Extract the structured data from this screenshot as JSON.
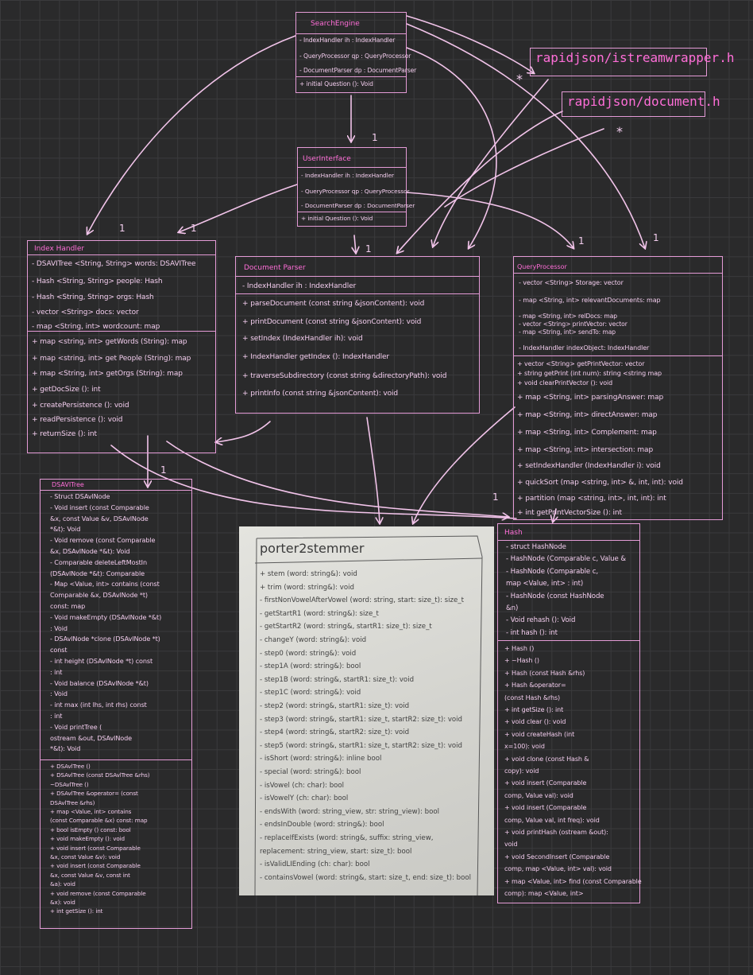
{
  "colors": {
    "background": "#2a2a2b",
    "ink": "#e49bd6",
    "title": "#ff6ed8"
  },
  "search_engine": {
    "title": "SearchEngine",
    "fields": [
      "- IndexHandler ih : IndexHandler",
      "- QueryProcessor qp : QueryProcessor",
      "- DocumentParser dp : DocumentParser"
    ],
    "methods": [
      "+ initial Question (): Void"
    ]
  },
  "libs": [
    "rapidjson/istreamwrapper.h",
    "rapidjson/document.h"
  ],
  "user_interface": {
    "title": "UserInterface",
    "fields": [
      "- IndexHandler ih : IndexHandler",
      "- QueryProcessor qp : QueryProcessor",
      "- DocumentParser dp : DocumentParser"
    ],
    "methods": [
      "+ initial Question (): Void"
    ]
  },
  "index_handler": {
    "title": "Index Handler",
    "fields": [
      "- DSAVITree <String, String> words: DSAVITree",
      "- Hash <String, String> people: Hash",
      "- Hash <String, String> orgs: Hash",
      "- vector <String> docs: vector",
      "- map <String, int> wordcount: map"
    ],
    "methods": [
      "+ map <string, int> getWords (String): map",
      "+ map <string, int> get People (String): map",
      "+ map <String, int> getOrgs (String): map",
      "+ getDocSize (): int",
      "+ createPersistence (): void",
      "+ readPersistence (): void",
      "+ returnSize (): int"
    ]
  },
  "document_parser": {
    "title": "Document Parser",
    "fields": [
      "- IndexHandler ih : IndexHandler"
    ],
    "methods": [
      "+ parseDocument (const string &jsonContent): void",
      "+ printDocument (const string &jsonContent): void",
      "+ setIndex (IndexHandler ih): void",
      "+ IndexHandler getIndex (): IndexHandler",
      "+ traverseSubdirectory (const string &directoryPath): void",
      "+ printInfo (const string &jsonContent): void"
    ]
  },
  "query_processor": {
    "title": "QueryProcessor",
    "fields": [
      "- vector <String> Storage: vector",
      "- map <String, int> relevantDocuments: map",
      "- map <String, int> relDocs: map",
      "- vector <String> printVector: vector",
      "- map <String, int> sendTo: map",
      "- IndexHandler indexObject: IndexHandler"
    ],
    "methods": [
      "+ vector <String> getPrintVector: vector",
      "+ string getPrint (int num): string <string map",
      "+ void clearPrintVector (): void",
      "+ map <String, int> parsingAnswer: map",
      "+ map <String, int> directAnswer: map",
      "+ map <String, int> Complement: map",
      "+ map <String, int> intersection: map",
      "+ setIndexHandler (IndexHandler i): void",
      "+ quickSort (map <string, int> &, int, int): void",
      "+ partition (map <string, int>, int, int): int",
      "+ int getPrintVectorSize (): int"
    ]
  },
  "dsavl_tree": {
    "title": "DSAVITree",
    "fields": [
      "- Struct DSAvlNode",
      "- Void insert (const Comparable",
      "  &x, const Value &v, DSAvlNode",
      "  *&t): Void",
      "- Void remove (const Comparable",
      "  &x, DSAvlNode *&t): Void",
      "- Comparable deleteLeftMostIn",
      "  (DSAvlNode *&t): Comparable",
      "- Map <Value, int> contains (const",
      "  Comparable &x, DSAvlNode *t)",
      "  const: map",
      "- Void makeEmpty (DSAvlNode *&t)",
      "  : Void",
      "- DSAvlNode *clone (DSAvlNode *t)",
      "  const",
      "- int height (DSAvlNode *t) const",
      "  : int",
      "- Void balance (DSAvlNode *&t)",
      "  : Void",
      "- int max (int lhs, int rhs) const",
      "  : int",
      "- Void printTree (",
      "  ostream &out, DSAvlNode",
      "  *&t): Void"
    ],
    "methods": [
      "+ DSAvlTree ()",
      "+ DSAvlTree (const DSAvlTree &rhs)",
      "  ~DSAvlTree ()",
      "+ DSAvlTree &operator= (const",
      "  DSAvlTree &rhs)",
      "+ map <Value, int> contains",
      "  (const Comparable &x) const: map",
      "+ bool isEmpty () const: bool",
      "+ void makeEmpty (): void",
      "+ void insert (const Comparable",
      "  &x, const Value &v): void",
      "+ void insert (const Comparable",
      "  &x, const Value &v, const int",
      "  &a): void",
      "+ void remove (const Comparable",
      "  &x): void",
      "+ int getSize (): int"
    ]
  },
  "porter": {
    "title": "porter2stemmer",
    "methods": [
      "+ stem (word: string&): void",
      "+ trim (word: string&): void",
      "- firstNonVowelAfterVowel (word: string, start: size_t): size_t",
      "- getStartR1 (word: string&): size_t",
      "- getStartR2 (word: string&, startR1: size_t): size_t",
      "- changeY (word: string&): void",
      "- step0 (word: string&): void",
      "- step1A (word: string&): bool",
      "- step1B (word: string&, startR1: size_t): void",
      "- step1C (word: string&): void",
      "- step2 (word: string&, startR1: size_t): void",
      "- step3 (word: string&, startR1: size_t, startR2: size_t): void",
      "- step4 (word: string&, startR2: size_t): void",
      "- step5 (word: string&, startR1: size_t, startR2: size_t): void",
      "- isShort (word: string&): inline bool",
      "- special (word: string&): bool",
      "- isVowel (ch: char): bool",
      "- isVowelY (ch: char): bool",
      "- endsWith (word: string_view, str: string_view): bool",
      "- endsInDouble (word: string&): bool",
      "- replaceIfExists (word: string&, suffix: string_view,",
      "    replacement: string_view, start: size_t): bool",
      "- isValidLIEnding (ch: char): bool",
      "- containsVowel (word: string&, start: size_t, end: size_t): bool"
    ]
  },
  "hash": {
    "title": "Hash",
    "fields": [
      "- struct HashNode",
      "- HashNode (Comparable c, Value &",
      "- HashNode (Comparable c,",
      "  map <Value, int> : int)",
      "- HashNode (const HashNode",
      "  &n)",
      "- Void rehash (): Void",
      "- int hash (): int"
    ],
    "methods": [
      "+ Hash ()",
      "+ ~Hash ()",
      "+ Hash (const Hash &rhs)",
      "+ Hash &operator=",
      "  (const Hash &rhs)",
      "+ int getSize (): int",
      "+ void clear (): void",
      "+ void createHash (int",
      "  x=100): void",
      "+ void clone (const Hash &",
      "  copy): void",
      "+ void insert (Comparable",
      "  comp, Value val): void",
      "+ void insert (Comparable",
      "  comp, Value val, int freq): void",
      "+ void printHash (ostream &out):",
      "  void",
      "+ void SecondInsert (Comparable",
      "  comp, map <Value, int> val): void",
      "+ map <Value, int> find (const Comparable",
      "  comp): map <Value, int>"
    ]
  },
  "annotations": [
    "1",
    "1",
    "1",
    "1",
    "1",
    "1",
    "1",
    "1",
    "*",
    "*"
  ]
}
